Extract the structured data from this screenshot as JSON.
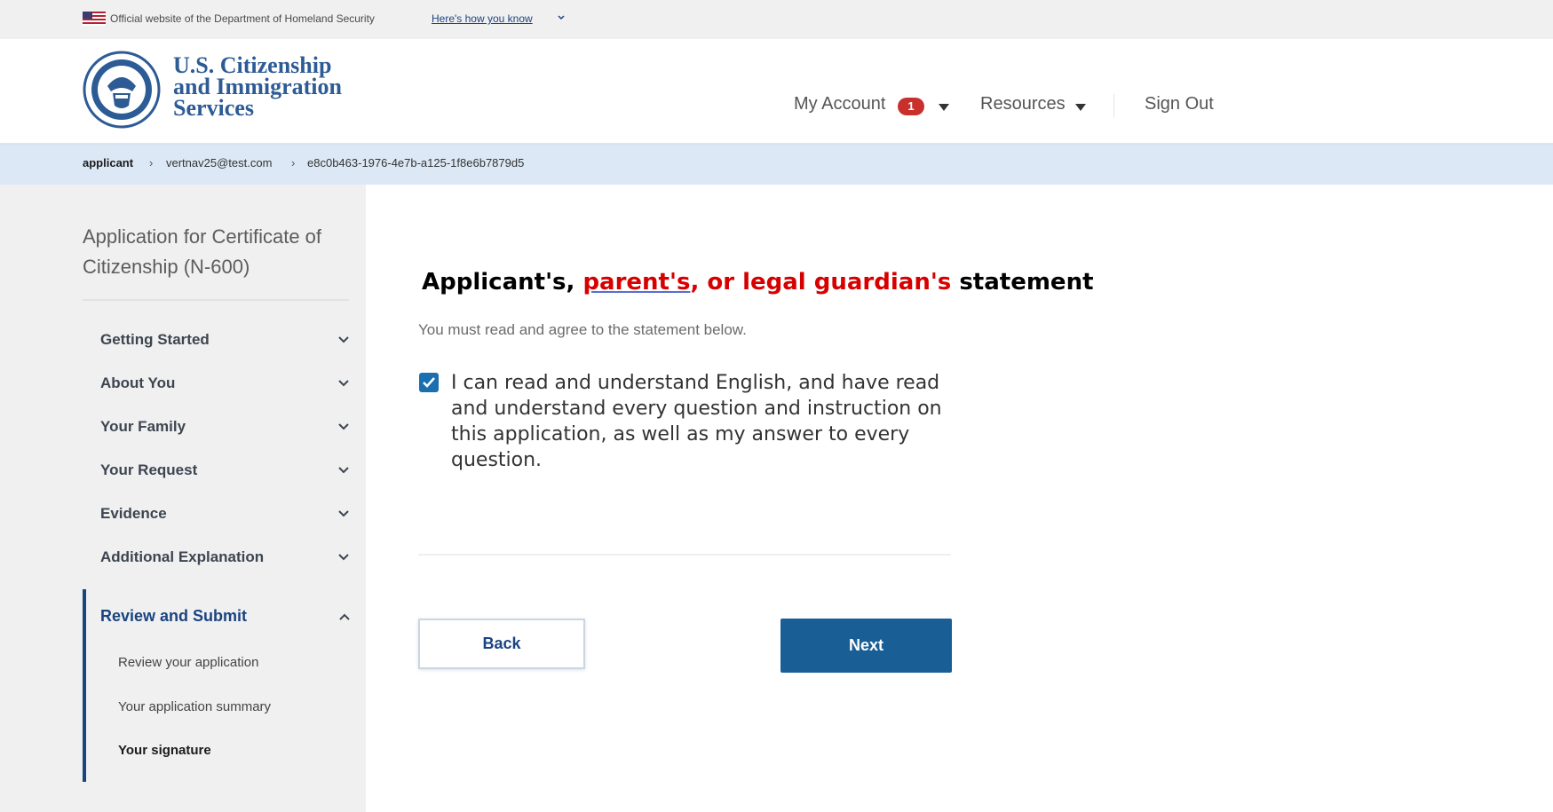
{
  "gov_banner": {
    "official_text": "Official website of the Department of Homeland Security",
    "how_you_know": "Here's how you know"
  },
  "header": {
    "agency_lines": [
      "U.S. Citizenship",
      "and Immigration",
      "Services"
    ],
    "nav": {
      "my_account": "My Account",
      "notification_count": "1",
      "resources": "Resources",
      "sign_out": "Sign Out"
    }
  },
  "breadcrumb": {
    "items": [
      "applicant",
      "vertnav25@test.com",
      "e8c0b463-1976-4e7b-a125-1f8e6b7879d5"
    ]
  },
  "sidebar": {
    "title": "Application for Certificate of Citizenship (N-600)",
    "sections": [
      {
        "label": "Getting Started"
      },
      {
        "label": "About You"
      },
      {
        "label": "Your Family"
      },
      {
        "label": "Your Request"
      },
      {
        "label": "Evidence"
      },
      {
        "label": "Additional Explanation"
      }
    ],
    "active_section": {
      "label": "Review and Submit",
      "items": [
        "Review your application",
        "Your application summary",
        "Your signature"
      ]
    }
  },
  "main": {
    "heading_part1": "Applicant's, ",
    "heading_part2": "parent's",
    "heading_part3": ", or legal guardian's",
    "heading_part4": " statement",
    "instruction": "You must read and agree to the statement below.",
    "statement_checked": true,
    "statement": "I can read and understand English, and have read and understand every question and instruction on this application, as well as my answer to every question.",
    "back_label": "Back",
    "next_label": "Next"
  },
  "colors": {
    "primary": "#1a5e96",
    "nav_blue": "#1a4480",
    "alert_red": "#c9302c",
    "breadcrumb_bg": "#dce8f5"
  }
}
